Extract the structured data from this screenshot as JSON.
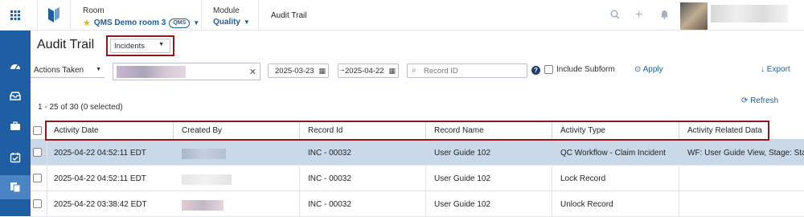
{
  "breadcrumb": {
    "room_label": "Room",
    "room_value": "QMS Demo room 3",
    "room_badge": "QMS",
    "module_label": "Module",
    "module_value": "Quality",
    "current": "Audit Trail"
  },
  "header": {
    "title": "Audit Trail",
    "module_filter": "Incidents"
  },
  "filters": {
    "actions_label": "Actions Taken",
    "date_from": "2025-03-23",
    "date_to": "2025-04-22",
    "record_placeholder": "Record ID",
    "include_subform_label": "Include Subform",
    "apply_label": "Apply",
    "export_label": "Export"
  },
  "list": {
    "selection_info": "1 - 25 of 30 (0 selected)",
    "refresh_label": "Refresh"
  },
  "table": {
    "columns": [
      "Activity Date",
      "Created By",
      "Record Id",
      "Record Name",
      "Activity Type",
      "Activity Related Data"
    ],
    "rows": [
      {
        "date": "2025-04-22 04:52:11 EDT",
        "record_id": "INC - 00032",
        "record_name": "User Guide 102",
        "type": "QC Workflow - Claim Incident",
        "related": "WF: User Guide View, Stage: Stag..."
      },
      {
        "date": "2025-04-22 04:52:11 EDT",
        "record_id": "INC - 00032",
        "record_name": "User Guide 102",
        "type": "Lock Record",
        "related": ""
      },
      {
        "date": "2025-04-22 03:38:42 EDT",
        "record_id": "INC - 00032",
        "record_name": "User Guide 102",
        "type": "Unlock Record",
        "related": ""
      }
    ]
  },
  "colors": {
    "sidebar": "#1f5ea3",
    "sidebar_active": "#4b84c4",
    "accent": "#1d5d9b",
    "highlight_box": "#8b1a1a",
    "selected_row": "#c9d9ea"
  }
}
